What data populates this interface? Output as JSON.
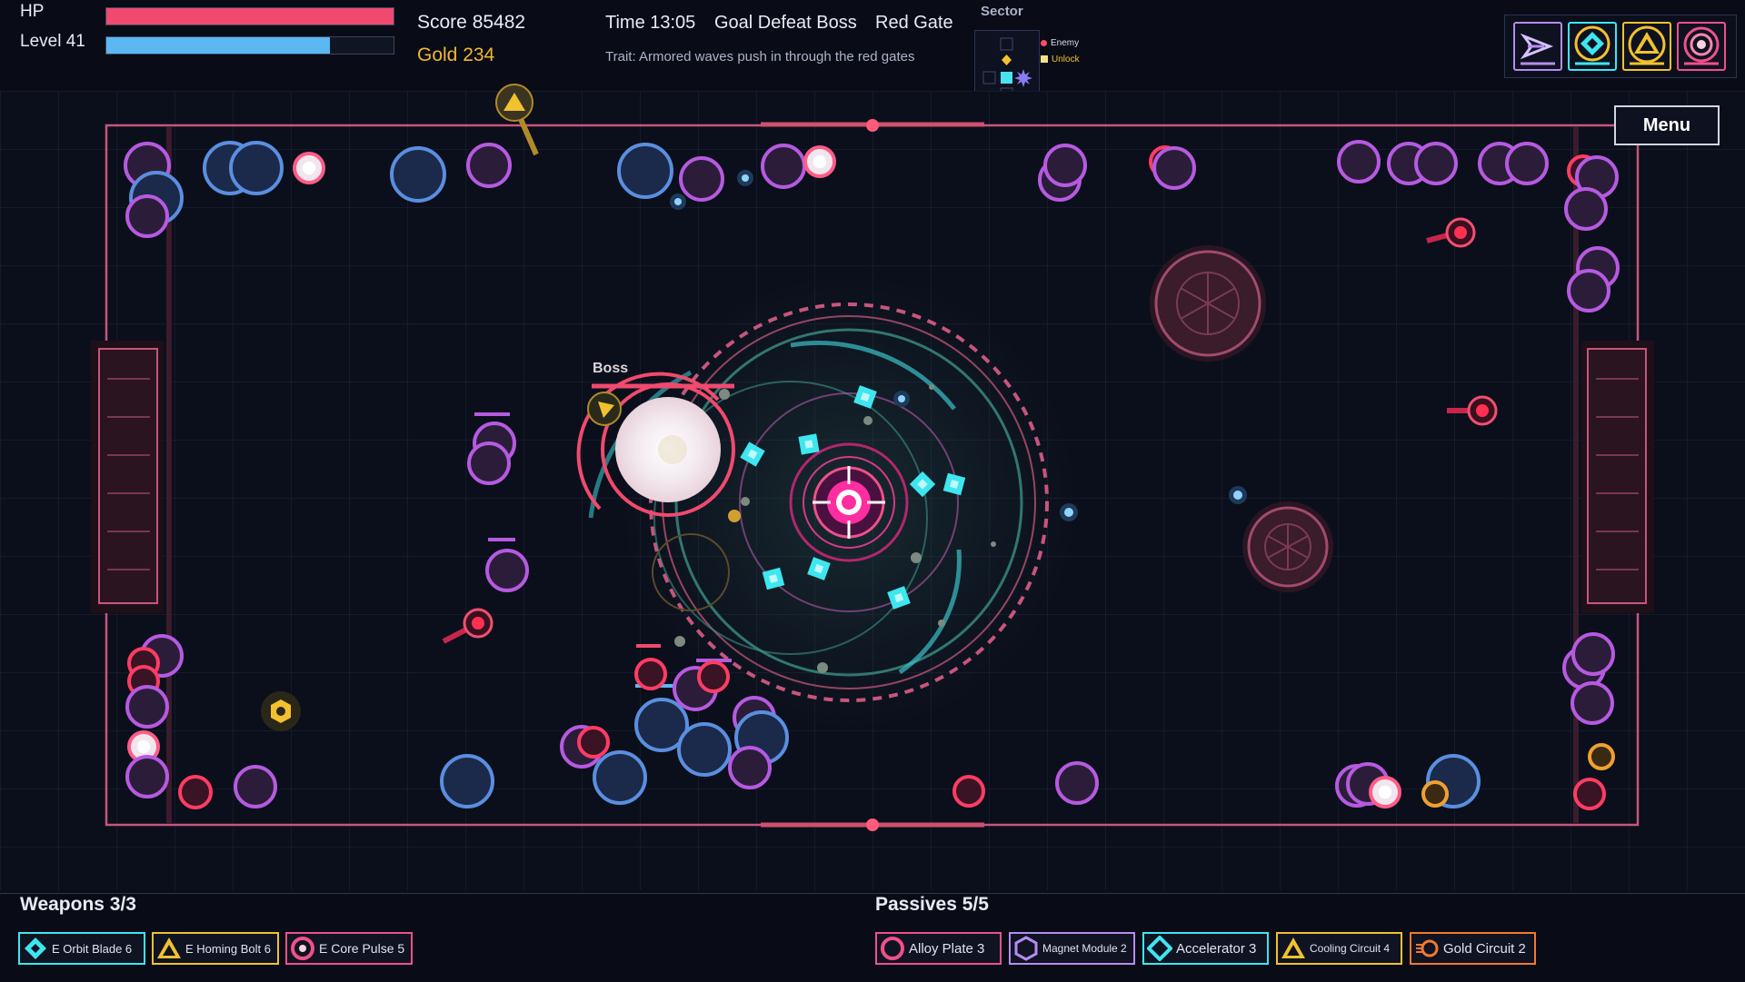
{
  "hud": {
    "hp_label": "HP",
    "hp_fraction": 1.0,
    "level_label": "Level 41",
    "xp_fraction": 0.78,
    "score_text": "Score 85482",
    "gold_text": "Gold 234",
    "time_text": "Time 13:05",
    "goal_text": "Goal Defeat Boss",
    "gate_text": "Red Gate",
    "trait_text": "Trait: Armored waves push in through the red gates",
    "colors": {
      "hp": "#f04a6e",
      "xp": "#5bb8f0",
      "gold": "#f2b632"
    }
  },
  "sector": {
    "title": "Sector",
    "legend": [
      {
        "label": "Enemy",
        "color": "#ff4a68"
      },
      {
        "label": "Unlock",
        "color": "#f5e08a"
      }
    ]
  },
  "ability_slots": [
    {
      "icon": "dash-arrow-icon",
      "color": "#b58cf0"
    },
    {
      "icon": "orbit-diamond-icon",
      "color": "#3ee6f0"
    },
    {
      "icon": "homing-triangle-icon",
      "color": "#f2c12e"
    },
    {
      "icon": "core-pulse-icon",
      "color": "#f0508a"
    }
  ],
  "menu_label": "Menu",
  "boss_label": "Boss",
  "weapons": {
    "title": "Weapons 3/3",
    "items": [
      {
        "label": "E Orbit Blade 6",
        "icon": "diamond-icon",
        "color": "#3ee6f0"
      },
      {
        "label": "E Homing Bolt 6",
        "icon": "triangle-icon",
        "color": "#f2c12e"
      },
      {
        "label": "E Core Pulse 5",
        "icon": "ring-icon",
        "color": "#f0508a"
      }
    ]
  },
  "passives": {
    "title": "Passives 5/5",
    "items": [
      {
        "label": "Alloy Plate 3",
        "icon": "ring-icon",
        "color": "#f0508a"
      },
      {
        "label": "Magnet Module 2",
        "icon": "hexagon-icon",
        "color": "#b58cf0"
      },
      {
        "label": "Accelerator 3",
        "icon": "diamond-icon",
        "color": "#3ee6f0"
      },
      {
        "label": "Cooling Circuit 4",
        "icon": "triangle-icon",
        "color": "#f2c12e"
      },
      {
        "label": "Gold Circuit 2",
        "icon": "coin-icon",
        "color": "#f07a2e"
      }
    ]
  }
}
